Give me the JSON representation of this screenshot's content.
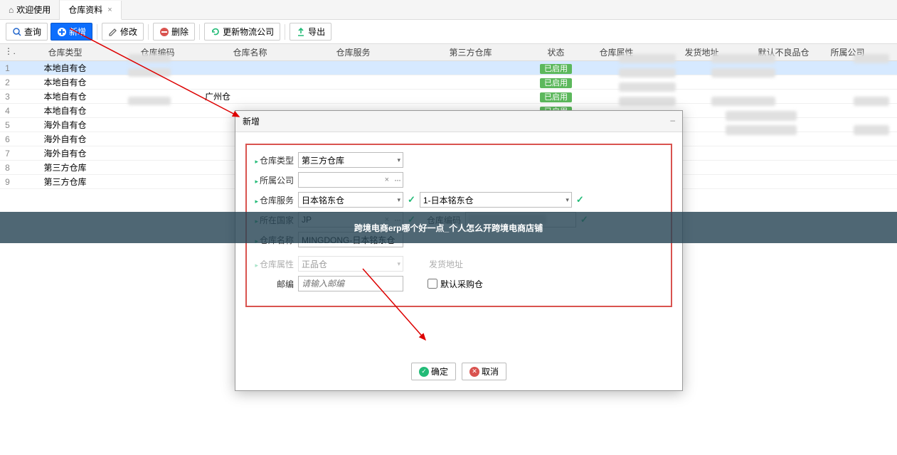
{
  "tabs": [
    {
      "label": "欢迎使用"
    },
    {
      "label": "仓库资料"
    }
  ],
  "toolbar": {
    "search": "查询",
    "add": "新增",
    "edit": "修改",
    "del": "删除",
    "refresh": "更新物流公司",
    "export": "导出"
  },
  "columns": {
    "type": "仓库类型",
    "code": "仓库编码",
    "name": "仓库名称",
    "svc": "仓库服务",
    "third": "第三方仓库",
    "status": "状态",
    "attr": "仓库属性",
    "addr": "发货地址",
    "def": "默认不良品仓",
    "comp": "所属公司"
  },
  "rows": [
    {
      "idx": "1",
      "type": "本地自有仓",
      "name": "",
      "status": "已启用"
    },
    {
      "idx": "2",
      "type": "本地自有仓",
      "name": "",
      "status": "已启用"
    },
    {
      "idx": "3",
      "type": "本地自有仓",
      "name": "广州仓",
      "status": "已启用"
    },
    {
      "idx": "4",
      "type": "本地自有仓",
      "name": "",
      "status": "已启用"
    },
    {
      "idx": "5",
      "type": "海外自有仓",
      "name": "",
      "status": ""
    },
    {
      "idx": "6",
      "type": "海外自有仓",
      "name": "",
      "status": ""
    },
    {
      "idx": "7",
      "type": "海外自有仓",
      "name": "",
      "status": ""
    },
    {
      "idx": "8",
      "type": "第三方仓库",
      "name": "",
      "status": ""
    },
    {
      "idx": "9",
      "type": "第三方仓库",
      "name": "",
      "status": ""
    }
  ],
  "modal": {
    "title": "新增",
    "fields": {
      "type_label": "仓库类型",
      "type_value": "第三方仓库",
      "company_label": "所属公司",
      "company_value": "",
      "service_label": "仓库服务",
      "service_value": "日本铭东仓",
      "service2_value": "1-日本铭东仓",
      "country_label": "所在国家",
      "country_value": "JP",
      "code_label": "仓库编码",
      "code_value": "",
      "name_label": "仓库名称",
      "name_value": "MINGDONG-日本铭东仓",
      "attr_label": "仓库属性",
      "attr_value": "正品仓",
      "addr_label": "发货地址",
      "zip_label": "邮编",
      "zip_placeholder": "请输入邮编",
      "default_cb": "默认采购仓"
    },
    "ok": "确定",
    "cancel": "取消"
  },
  "overlay": "跨境电商erp哪个好一点_个人怎么开跨境电商店铺"
}
